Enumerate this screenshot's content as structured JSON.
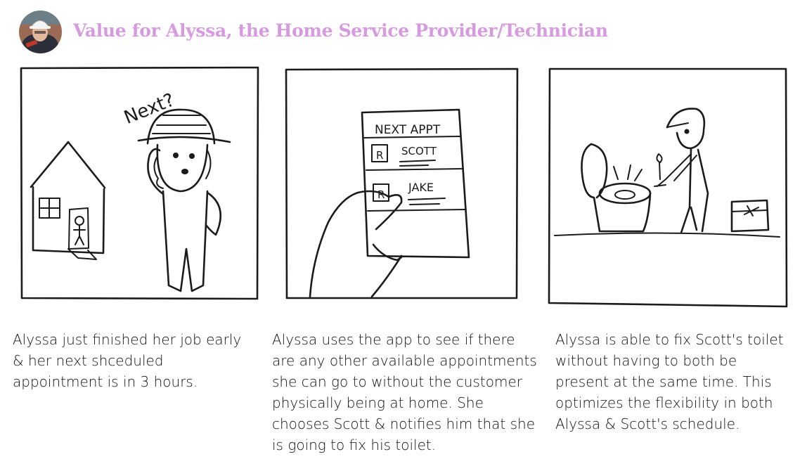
{
  "header": {
    "title": "Value for Alyssa, the Home Service Provider/Technician",
    "avatar_icon": "technician-avatar-icon"
  },
  "panels": [
    {
      "sketch_text": "Next?",
      "caption": "Alyssa just finished her job early & her next shceduled appointment is in 3 hours."
    },
    {
      "sketch_text": {
        "heading": "NEXT APPT",
        "item_1": "SCOTT",
        "item_2": "JAKE"
      },
      "caption": "Alyssa uses the app to see if there are any other available appointments she can go to without the customer physically being at home. She chooses Scott & notifies him that she is going to fix his toilet."
    },
    {
      "caption": "Alyssa is able to fix Scott's toilet without having to both be present at the same time. This optimizes the flexibility in both Alyssa & Scott's schedule."
    }
  ],
  "colors": {
    "title": "#d79ae0",
    "ink": "#1b1b1b",
    "caption_text": "#111111"
  }
}
